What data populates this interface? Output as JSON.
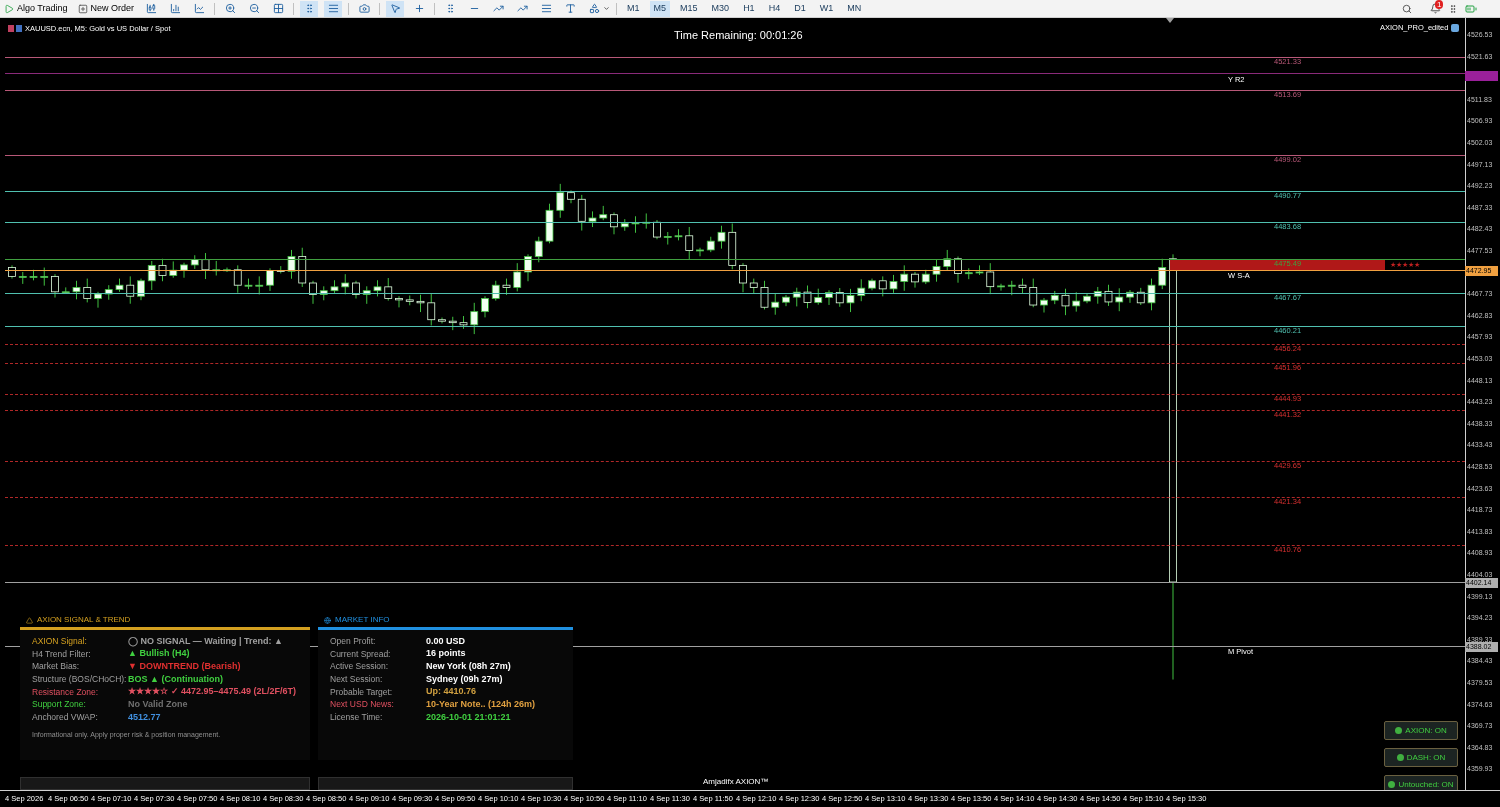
{
  "toolbar": {
    "buttons": [
      {
        "kind": "algo",
        "label": "Algo Trading"
      },
      {
        "kind": "order",
        "label": "New Order"
      }
    ],
    "timeframes": [
      {
        "label": "M1",
        "selected": false
      },
      {
        "label": "M5",
        "selected": true
      },
      {
        "label": "M15",
        "selected": false
      },
      {
        "label": "M30",
        "selected": false
      },
      {
        "label": "H1",
        "selected": false
      },
      {
        "label": "H4",
        "selected": false
      },
      {
        "label": "D1",
        "selected": false
      },
      {
        "label": "W1",
        "selected": false
      },
      {
        "label": "MN",
        "selected": false
      }
    ],
    "notification_count": "1"
  },
  "chart": {
    "symbol": "XAUUSD.ecn, M5: Gold vs US Dollar / Spot",
    "timer": "Time Remaining: 00:01:26",
    "indicator": "AXION_PRO_edited",
    "levels": [
      {
        "label": "4521.33",
        "color": "#b85878",
        "kind": "solid"
      },
      {
        "color": "#8a2a7a",
        "kind": "solid"
      },
      {
        "label": "4513.69",
        "color": "#b85878",
        "kind": "solid"
      },
      {
        "label": "4499.02",
        "color": "#b85878",
        "kind": "solid"
      },
      {
        "label": "4490.77",
        "color": "#50c0b0",
        "kind": "solid"
      },
      {
        "label": "4483.68",
        "color": "#50c0b0",
        "kind": "solid"
      },
      {
        "label": "4475.49",
        "color": "#40a040",
        "kind": "solid"
      },
      {
        "color": "#f0a040",
        "kind": "solid"
      },
      {
        "label": "4467.67",
        "color": "#50c0b0",
        "kind": "solid"
      },
      {
        "label": "4460.21",
        "color": "#50c0b0",
        "kind": "solid"
      },
      {
        "label": "4456.24",
        "color": "#b02828",
        "kind": "dashed"
      },
      {
        "label": "4451.96",
        "color": "#b02828",
        "kind": "dashed"
      },
      {
        "label": "4444.93",
        "color": "#b02828",
        "kind": "dashed"
      },
      {
        "label": "4441.32",
        "color": "#b02828",
        "kind": "dashed"
      },
      {
        "label": "4429.65",
        "color": "#b02828",
        "kind": "dashed"
      },
      {
        "label": "4421.34",
        "color": "#b02828",
        "kind": "dashed"
      },
      {
        "label": "4410.76",
        "color": "#b02828",
        "kind": "dashed"
      },
      {
        "color": "#a0a0a0",
        "kind": "solid"
      },
      {
        "color": "#a0a0a0",
        "kind": "solid"
      }
    ],
    "level_tags": [
      "Y R2",
      "W S-A",
      "M Pivot"
    ],
    "zone_rating": "★★★★★",
    "price_ticks": [
      "4526.53",
      "4521.63",
      "4511.83",
      "4506.93",
      "4502.03",
      "4497.13",
      "4492.23",
      "4487.33",
      "4482.43",
      "4477.53",
      "4467.73",
      "4462.83",
      "4457.93",
      "4453.03",
      "4448.13",
      "4443.23",
      "4438.33",
      "4433.43",
      "4428.53",
      "4423.63",
      "4418.73",
      "4413.83",
      "4408.93",
      "4404.03",
      "4399.13",
      "4394.23",
      "4389.33",
      "4384.43",
      "4379.53",
      "4374.63",
      "4369.73",
      "4364.83",
      "4359.93"
    ],
    "price_tags": [
      {
        "color": "#9a209a"
      },
      {
        "label": "4472.95",
        "color": "#f0a040"
      },
      {
        "label": "4402.14",
        "color": "#b0b0b0"
      },
      {
        "label": "4388.02",
        "color": "#b0b0b0"
      }
    ],
    "time_axis": [
      "4 Sep 2026",
      "4 Sep 06:50",
      "4 Sep 07:10",
      "4 Sep 07:30",
      "4 Sep 07:50",
      "4 Sep 08:10",
      "4 Sep 08:30",
      "4 Sep 08:50",
      "4 Sep 09:10",
      "4 Sep 09:30",
      "4 Sep 09:50",
      "4 Sep 10:10",
      "4 Sep 10:30",
      "4 Sep 10:50",
      "4 Sep 11:10",
      "4 Sep 11:30",
      "4 Sep 11:50",
      "4 Sep 12:10",
      "4 Sep 12:30",
      "4 Sep 12:50",
      "4 Sep 13:10",
      "4 Sep 13:30",
      "4 Sep 13:50",
      "4 Sep 14:10",
      "4 Sep 14:30",
      "4 Sep 14:50",
      "4 Sep 15:10",
      "4 Sep 15:30"
    ],
    "footer": "Amjadifx AXION™"
  },
  "signal_panel": {
    "title": "AXION SIGNAL & TREND",
    "rows": [
      {
        "label": "AXION Signal:",
        "kind": "signal",
        "value": "◯ NO SIGNAL — Waiting | Trend: ▲",
        "color": "#a0a0a0"
      },
      {
        "label": "H4 Trend Filter:",
        "kind": "plain",
        "value": "▲ Bullish (H4)",
        "color": "#40d040"
      },
      {
        "label": "Market Bias:",
        "kind": "plain",
        "value": "▼ DOWNTREND (Bearish)",
        "color": "#e03030"
      },
      {
        "label": "Structure (BOS/CHoCH):",
        "kind": "plain",
        "value": "BOS ▲ (Continuation)",
        "color": "#40d040"
      },
      {
        "label": "Resistance Zone:",
        "kind": "resistance",
        "value": "★★★★☆ ✓ 4472.95–4475.49 (2L/2F/6T)",
        "color": "#e05060"
      },
      {
        "label": "Support Zone:",
        "kind": "support",
        "value": "No Valid Zone",
        "color": "#707070"
      },
      {
        "label": "Anchored VWAP:",
        "kind": "plain",
        "value": "4512.77",
        "color": "#4090e0"
      }
    ],
    "note": "Informational only. Apply proper risk & position management."
  },
  "market_panel": {
    "title": "MARKET INFO",
    "rows": [
      {
        "label": "Open Profit:",
        "kind": "plain",
        "value": "0.00 USD",
        "color": "#ffffff"
      },
      {
        "label": "Current Spread:",
        "kind": "plain",
        "value": "16 points",
        "color": "#ffffff"
      },
      {
        "label": "Active Session:",
        "kind": "plain",
        "value": "New York (08h 27m)",
        "color": "#ffffff"
      },
      {
        "label": "Next Session:",
        "kind": "plain",
        "value": "Sydney (09h 27m)",
        "color": "#ffffff"
      },
      {
        "label": "Probable Target:",
        "kind": "plain",
        "value": "Up: 4410.76",
        "color": "#d0a040"
      },
      {
        "label": "Next USD News:",
        "kind": "resistance",
        "value": "10-Year Note.. (124h 26m)",
        "color": "#e0a040"
      },
      {
        "label": "License Time:",
        "kind": "plain",
        "value": "2026-10-01 21:01:21",
        "color": "#40d040"
      }
    ]
  },
  "toggles": [
    {
      "label": "AXION: ON",
      "on": true
    },
    {
      "label": "DASH: ON",
      "on": true
    },
    {
      "label": "Untouched: ON",
      "on": true
    }
  ]
}
